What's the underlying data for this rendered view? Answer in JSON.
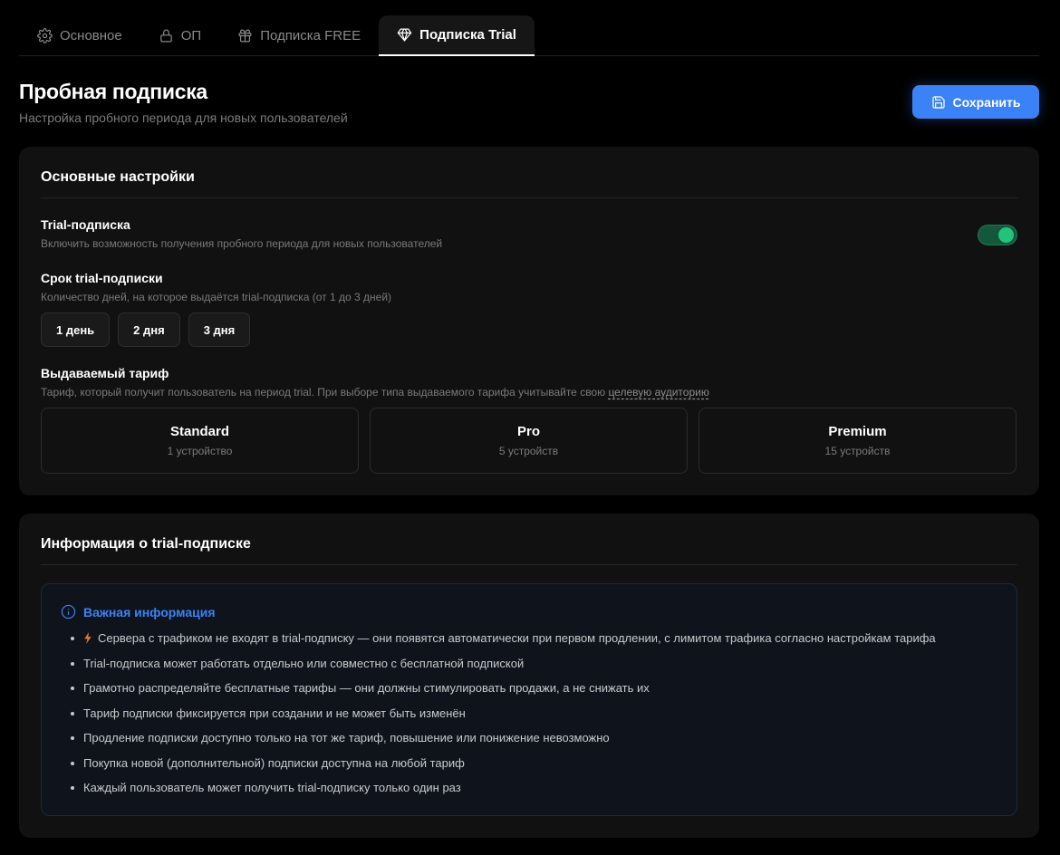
{
  "tabs": [
    {
      "label": "Основное",
      "icon": "gear-icon",
      "active": false
    },
    {
      "label": "ОП",
      "icon": "lock-icon",
      "active": false
    },
    {
      "label": "Подписка FREE",
      "icon": "gift-icon",
      "active": false
    },
    {
      "label": "Подписка Trial",
      "icon": "diamond-icon",
      "active": true
    }
  ],
  "header": {
    "title": "Пробная подписка",
    "subtitle": "Настройка пробного периода для новых пользователей",
    "save_label": "Сохранить"
  },
  "main_settings": {
    "title": "Основные настройки",
    "trial_toggle": {
      "label": "Trial-подписка",
      "description": "Включить возможность получения пробного периода для новых пользователей",
      "enabled": true,
      "color": "#22c47a"
    },
    "duration": {
      "label": "Срок trial-подписки",
      "description": "Количество дней, на которое выдаётся trial-подписка (от 1 до 3 дней)",
      "options": [
        "1 день",
        "2 дня",
        "3 дня"
      ]
    },
    "tariff": {
      "label": "Выдаваемый тариф",
      "description": "Тариф, который получит пользователь на период trial. При выборе типа выдаваемого тарифа учитывайте свою ",
      "link": "целевую аудиторию",
      "plans": [
        {
          "name": "Standard",
          "devices": "1 устройство"
        },
        {
          "name": "Pro",
          "devices": "5 устройств"
        },
        {
          "name": "Premium",
          "devices": "15 устройств"
        }
      ]
    }
  },
  "info": {
    "title": "Информация о trial-подписке",
    "box_title": "Важная информация",
    "accent": "#3b82f6",
    "items": [
      "Сервера с трафиком не входят в trial-подписку — они появятся автоматически при первом продлении, с лимитом трафика согласно настройкам тарифа",
      "Trial-подписка может работать отдельно или совместно с бесплатной подпиской",
      "Грамотно распределяйте бесплатные тарифы — они должны стимулировать продажи, а не снижать их",
      "Тариф подписки фиксируется при создании и не может быть изменён",
      "Продление подписки доступно только на тот же тариф, повышение или понижение невозможно",
      "Покупка новой (дополнительной) подписки доступна на любой тариф",
      "Каждый пользователь может получить trial-подписку только один раз"
    ]
  }
}
